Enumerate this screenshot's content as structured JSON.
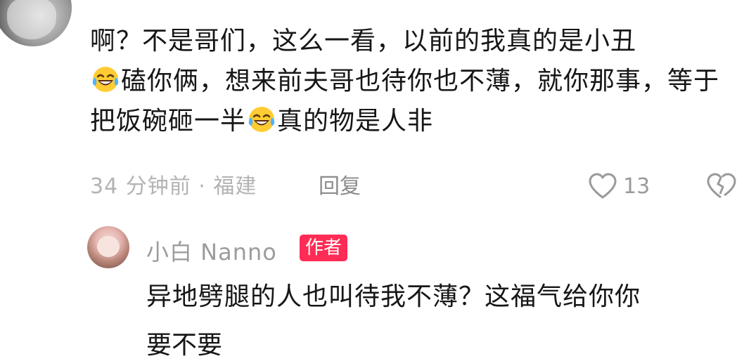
{
  "comment": {
    "parts": [
      "啊？不是哥们，这么一看，以前的我真的是小丑",
      "磕你俩，想来前夫哥也待你也不薄，就你那事，等于把饭碗砸一半",
      "真的物是人非"
    ],
    "emoji_name": "laughing-crying-emoji",
    "meta": "34 分钟前 · 福建",
    "reply_label": "回复",
    "likes": "13"
  },
  "reply": {
    "author": "小白 Nanno",
    "badge": "作者",
    "text": "异地劈腿的人也叫待我不薄？这福气给你你",
    "next_line_partial": "要不要"
  },
  "colors": {
    "text": "#161616",
    "meta": "#b3b3b3",
    "badge_bg": "#ff2c55",
    "icon": "#9a9a9a"
  }
}
